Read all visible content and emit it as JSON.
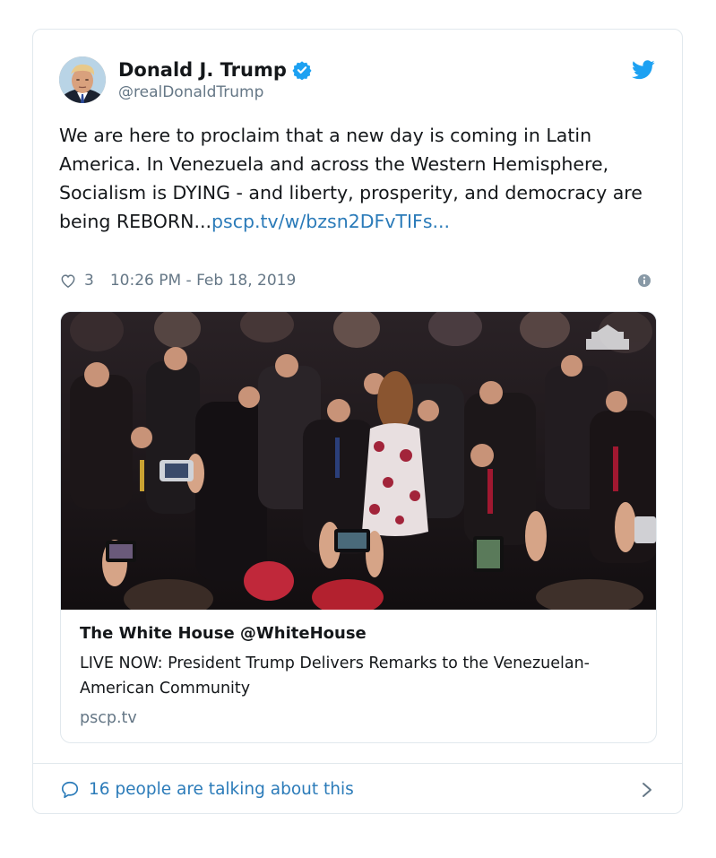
{
  "author": {
    "display_name": "Donald J. Trump",
    "handle": "@realDonaldTrump",
    "verified": true
  },
  "tweet": {
    "text_main": "We are here to proclaim that a new day is coming in Latin America. In Venezuela and across the Western Hemisphere, Socialism is DYING - and liberty, prosperity, and democracy are being REBORN...",
    "link_text": "pscp.tv/w/bzsn2DFvTIFs...",
    "likes": "3",
    "timestamp": "10:26 PM - Feb 18, 2019"
  },
  "card": {
    "title": "The White House @WhiteHouse",
    "description": "LIVE NOW: President Trump Delivers Remarks to the Venezuelan-American Community",
    "domain": "pscp.tv"
  },
  "footer": {
    "talking_text": "16 people are talking about this"
  },
  "colors": {
    "link": "#2b7bb9",
    "verified": "#1da1f2",
    "muted": "#657786",
    "border": "#e1e8ed"
  },
  "icons": {
    "bird": "twitter-bird-icon",
    "heart": "heart-outline-icon",
    "info": "info-icon",
    "reply": "speech-bubble-icon",
    "chevron": "chevron-right-icon"
  }
}
